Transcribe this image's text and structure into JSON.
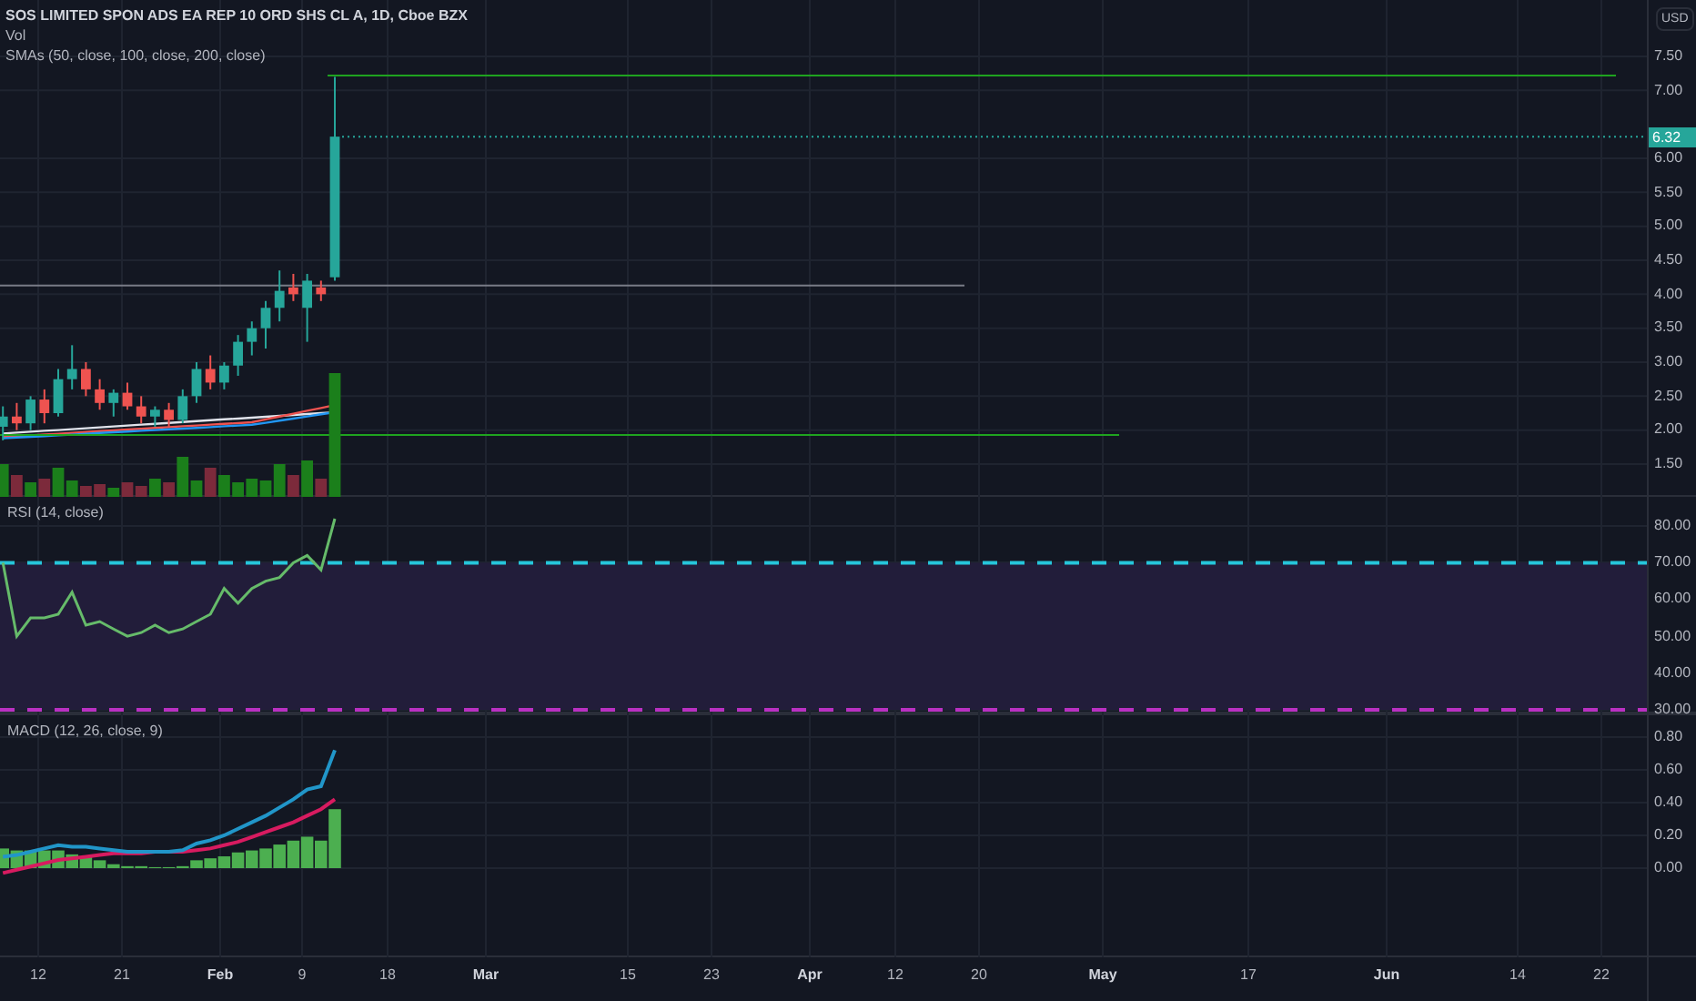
{
  "header": {
    "title": "SOS LIMITED SPON ADS EA REP 10 ORD SHS CL A, 1D, Cboe BZX",
    "volume_label": "Vol",
    "sma_label": "SMAs (50, close, 100, close, 200, close)"
  },
  "price_axis": {
    "currency": "USD",
    "ticks": [
      "7.50",
      "7.00",
      "6.00",
      "5.50",
      "5.00",
      "4.50",
      "4.00",
      "3.50",
      "3.00",
      "2.50",
      "2.00",
      "1.50"
    ],
    "last_price": "6.32"
  },
  "rsi": {
    "label": "RSI (14, close)",
    "ticks": [
      "80.00",
      "70.00",
      "60.00",
      "50.00",
      "40.00",
      "30.00"
    ]
  },
  "macd": {
    "label": "MACD (12, 26, close, 9)",
    "ticks": [
      "0.80",
      "0.60",
      "0.40",
      "0.20",
      "0.00"
    ]
  },
  "time_axis": {
    "ticks": [
      {
        "label": "12",
        "kind": "day"
      },
      {
        "label": "21",
        "kind": "day"
      },
      {
        "label": "Feb",
        "kind": "month"
      },
      {
        "label": "9",
        "kind": "day"
      },
      {
        "label": "18",
        "kind": "day"
      },
      {
        "label": "Mar",
        "kind": "month"
      },
      {
        "label": "15",
        "kind": "day"
      },
      {
        "label": "23",
        "kind": "day"
      },
      {
        "label": "Apr",
        "kind": "month"
      },
      {
        "label": "12",
        "kind": "day"
      },
      {
        "label": "20",
        "kind": "day"
      },
      {
        "label": "May",
        "kind": "month"
      },
      {
        "label": "17",
        "kind": "day"
      },
      {
        "label": "Jun",
        "kind": "month"
      },
      {
        "label": "14",
        "kind": "day"
      },
      {
        "label": "22",
        "kind": "day"
      }
    ]
  }
}
